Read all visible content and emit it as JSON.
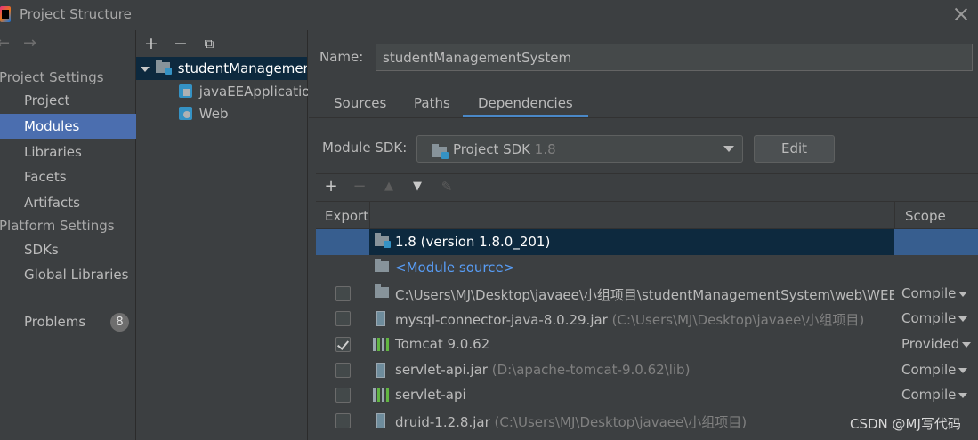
{
  "window": {
    "title": "Project Structure"
  },
  "nav": {
    "project_settings_header": "Project Settings",
    "project_settings_items": [
      "Project",
      "Modules",
      "Libraries",
      "Facets",
      "Artifacts"
    ],
    "platform_settings_header": "Platform Settings",
    "platform_settings_items": [
      "SDKs",
      "Global Libraries"
    ],
    "problems_label": "Problems",
    "problems_count": "8",
    "selected": "Modules"
  },
  "tree": {
    "root": "studentManagementSystem",
    "children": [
      "javaEEApplication",
      "Web"
    ]
  },
  "module": {
    "name_label": "Name:",
    "name_value": "studentManagementSystem",
    "tabs": [
      "Sources",
      "Paths",
      "Dependencies"
    ],
    "active_tab": "Dependencies",
    "sdk_label": "Module SDK:",
    "sdk_value": "Project SDK",
    "sdk_version": "1.8",
    "edit_label": "Edit"
  },
  "dependencies": {
    "columns": {
      "export": "Export",
      "scope": "Scope"
    },
    "rows": [
      {
        "icon": "jdk-folder-icon",
        "name": "1.8 (version 1.8.0_201)",
        "path": "",
        "scope": "",
        "checkbox": false,
        "selected": true
      },
      {
        "icon": "module-source-icon",
        "name": "<Module source>",
        "path": "",
        "scope": "",
        "checkbox": false,
        "link": true
      },
      {
        "icon": "folder-icon",
        "name": "C:\\Users\\MJ\\Desktop\\javaee\\小组项目\\studentManagementSystem\\web\\WEB-I",
        "path": "",
        "scope": "Compile",
        "checkbox": true,
        "checked": false
      },
      {
        "icon": "jar-icon",
        "name": "mysql-connector-java-8.0.29.jar",
        "path": "(C:\\Users\\MJ\\Desktop\\javaee\\小组项目)",
        "scope": "Compile",
        "checkbox": true,
        "checked": false
      },
      {
        "icon": "library-icon",
        "name": "Tomcat 9.0.62",
        "path": "",
        "scope": "Provided",
        "checkbox": true,
        "checked": true
      },
      {
        "icon": "jar-icon",
        "name": "servlet-api.jar",
        "path": "(D:\\apache-tomcat-9.0.62\\lib)",
        "scope": "Compile",
        "checkbox": true,
        "checked": false
      },
      {
        "icon": "library-icon",
        "name": "servlet-api",
        "path": "",
        "scope": "Compile",
        "checkbox": true,
        "checked": false
      },
      {
        "icon": "jar-icon",
        "name": "druid-1.2.8.jar",
        "path": "(C:\\Users\\MJ\\Desktop\\javaee\\小组项目)",
        "scope": "Compile",
        "checkbox": true,
        "checked": false
      }
    ]
  },
  "watermark": "CSDN @MJ写代码",
  "colors": {
    "background": "#3c3f41",
    "selection": "#4b6eaf",
    "tree_selection": "#0d293e",
    "accent": "#4a88c7",
    "link": "#589df6"
  }
}
